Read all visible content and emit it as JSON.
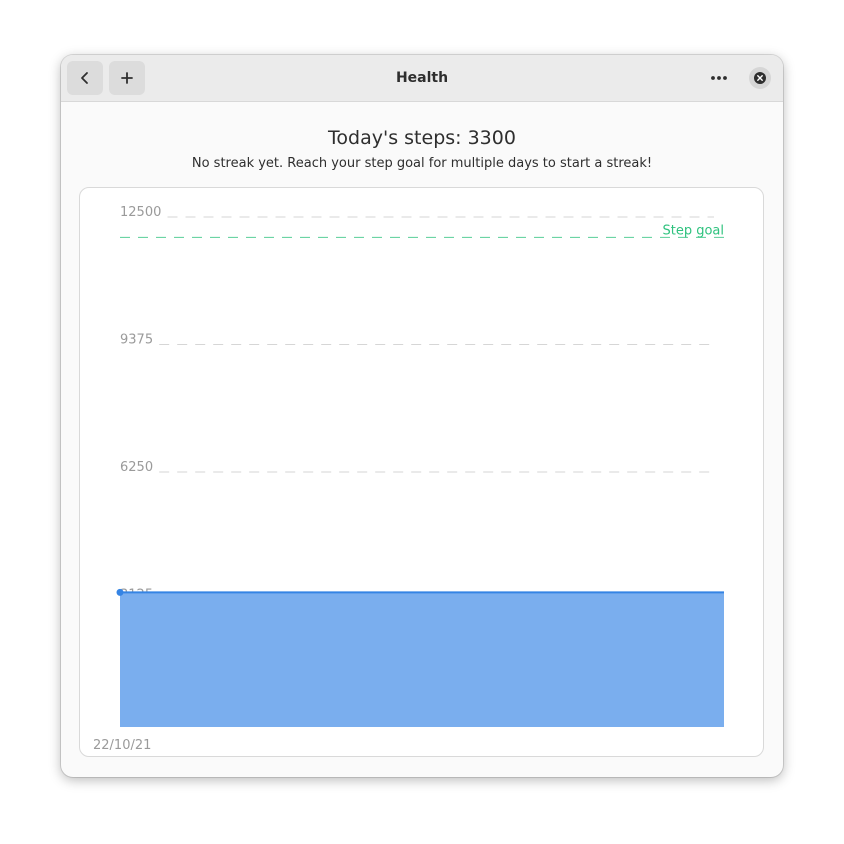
{
  "window": {
    "title": "Health"
  },
  "header": {
    "back_icon": "chevron-left-icon",
    "add_icon": "plus-icon",
    "menu_icon": "three-dots-icon",
    "close_icon": "close-x-icon"
  },
  "main": {
    "heading": "Today's steps: 3300",
    "streak_text": "No streak yet. Reach your step goal for multiple days to start a streak!"
  },
  "colors": {
    "goal_line": "#2ec27e",
    "area_fill": "#7aaeee",
    "area_line": "#3584e4",
    "grid": "#d6d6d6"
  },
  "chart_data": {
    "type": "area",
    "x": [
      "22/10/21"
    ],
    "series": [
      {
        "values": [
          3300
        ]
      }
    ],
    "y_ticks": [
      3125,
      6250,
      9375,
      12500
    ],
    "ylim": [
      0,
      12500
    ],
    "goal": {
      "label": "Step goal",
      "value": 12000
    },
    "grid": true
  }
}
